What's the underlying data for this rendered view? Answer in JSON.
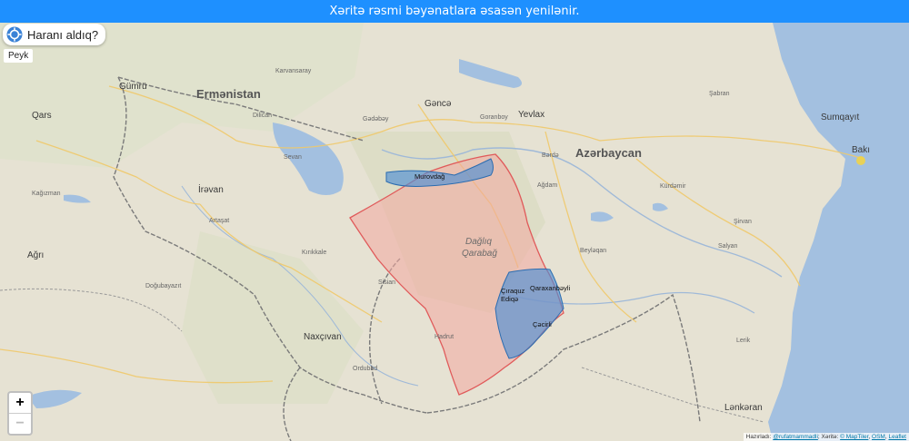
{
  "banner": {
    "text": "Xəritə rəsmi bəyənatlara əsasən yenilənir."
  },
  "where_button": {
    "label": "Haranı aldıq?",
    "icon": "crosshair-icon"
  },
  "layer_button": {
    "label": "Peyk"
  },
  "zoom": {
    "in_label": "+",
    "out_label": "−"
  },
  "attribution": {
    "prefix": "Hazırladı:",
    "author": "@rufatmammadli",
    "sep1": "; Xəritə:",
    "tiler": "© MapTiler",
    "sep2": ",",
    "osm": "OSM",
    "sep3": ",",
    "leaflet": "Leaflet"
  },
  "labels": {
    "countries": {
      "armenia": "Ermənistan",
      "azerbaijan": "Azərbaycan"
    },
    "region": {
      "line1": "Dağlıq",
      "line2": "Qarabağ"
    },
    "cities": {
      "gumri": "Gümrü",
      "qars": "Qars",
      "irevan": "İrəvan",
      "agri": "Ağrı",
      "naxcivan": "Naxçıvan",
      "gence": "Gəncə",
      "yevlax": "Yevlax",
      "sumqayit": "Sumqayıt",
      "baki": "Bakı",
      "lenkeran": "Lənkəran"
    },
    "regions": {
      "murovdag": "Murovdağ",
      "ciraquz": "Çıraquz",
      "ediqe": "Ediqə",
      "qaraxanbeyli": "Qaraxanbəyli",
      "cicirli": "Çəcirli"
    },
    "small": [
      "Kağızman",
      "Artaşat",
      "Sevan",
      "Kırıkkale",
      "Goranboy",
      "Beyləqan",
      "Şirvan",
      "Salyan",
      "Ordubad",
      "Dilican",
      "Karvansaray",
      "Hadrut",
      "Sisian",
      "Doğubayazıt",
      "Gədəbəy",
      "Ağdam",
      "Bərdə",
      "Kürdəmir",
      "Şabran",
      "Lerik"
    ]
  },
  "colors": {
    "banner": "#1e90ff",
    "occupied": "#f2a8a0",
    "liberated": "#4f8fd4",
    "water": "#a3c0e0"
  }
}
